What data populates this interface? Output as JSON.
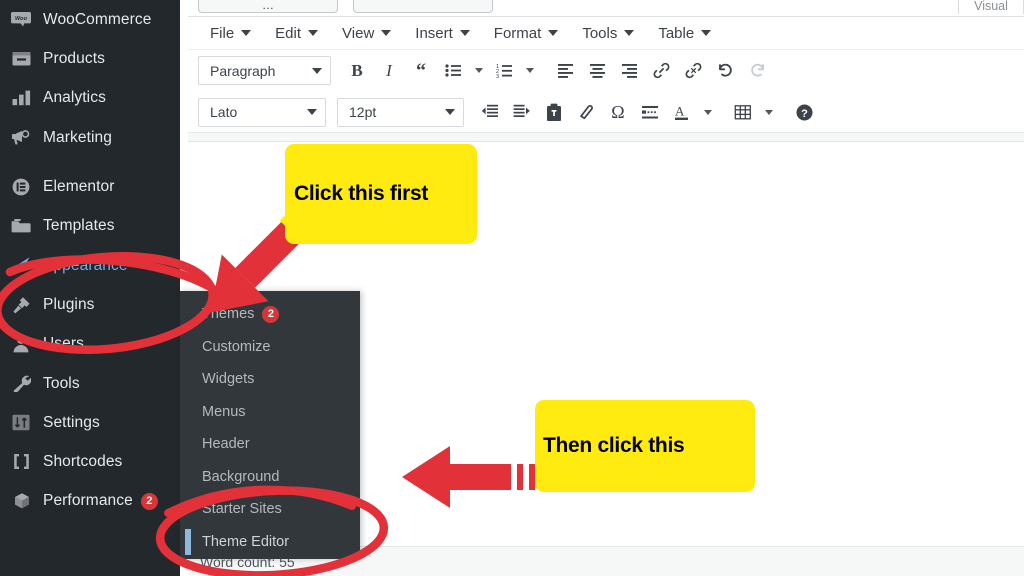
{
  "sidebar": {
    "items": [
      {
        "label": "WooCommerce",
        "icon": "woocommerce-icon",
        "badge": null,
        "active": false
      },
      {
        "label": "Products",
        "icon": "products-icon",
        "badge": null,
        "active": false
      },
      {
        "label": "Analytics",
        "icon": "analytics-icon",
        "badge": null,
        "active": false
      },
      {
        "label": "Marketing",
        "icon": "marketing-icon",
        "badge": null,
        "active": false
      },
      {
        "label": "Elementor",
        "icon": "elementor-icon",
        "badge": null,
        "active": false
      },
      {
        "label": "Templates",
        "icon": "templates-icon",
        "badge": null,
        "active": false
      },
      {
        "label": "Appearance",
        "icon": "appearance-icon",
        "badge": null,
        "active": true
      },
      {
        "label": "Plugins",
        "icon": "plugins-icon",
        "badge": null,
        "active": false
      },
      {
        "label": "Users",
        "icon": "users-icon",
        "badge": null,
        "active": false
      },
      {
        "label": "Tools",
        "icon": "tools-icon",
        "badge": null,
        "active": false
      },
      {
        "label": "Settings",
        "icon": "settings-icon",
        "badge": null,
        "active": false
      },
      {
        "label": "Shortcodes",
        "icon": "shortcodes-icon",
        "badge": null,
        "active": false
      },
      {
        "label": "Performance",
        "icon": "performance-icon",
        "badge": "2",
        "active": false
      }
    ]
  },
  "submenu": {
    "items": [
      {
        "label": "Themes",
        "badge": "2",
        "current": false
      },
      {
        "label": "Customize",
        "badge": null,
        "current": false
      },
      {
        "label": "Widgets",
        "badge": null,
        "current": false
      },
      {
        "label": "Menus",
        "badge": null,
        "current": false
      },
      {
        "label": "Header",
        "badge": null,
        "current": false
      },
      {
        "label": "Background",
        "badge": null,
        "current": false
      },
      {
        "label": "Starter Sites",
        "badge": null,
        "current": false
      },
      {
        "label": "Theme Editor",
        "badge": null,
        "current": true
      }
    ]
  },
  "editor": {
    "visual_tab_label": "Visual",
    "menubar": [
      "File",
      "Edit",
      "View",
      "Insert",
      "Format",
      "Tools",
      "Table"
    ],
    "format_select": "Paragraph",
    "font_select": "Lato",
    "size_select": "12pt",
    "row1_buttons": [
      "bold-icon",
      "italic-icon",
      "blockquote-icon",
      "bulleted-list-icon",
      "bulleted-list-caret-icon",
      "numbered-list-icon",
      "numbered-list-caret-icon",
      "align-left-icon",
      "align-center-icon",
      "align-right-icon",
      "insert-link-icon",
      "remove-link-icon",
      "undo-icon",
      "redo-icon"
    ],
    "row2_buttons": [
      "decrease-indent-icon",
      "increase-indent-icon",
      "paste-as-text-icon",
      "clear-formatting-icon",
      "special-character-icon",
      "insert-read-more-icon",
      "text-color-icon",
      "text-color-caret-icon",
      "table-icon",
      "table-caret-icon",
      "keyboard-shortcuts-icon"
    ],
    "word_count": "Word count: 55"
  },
  "annotations": {
    "callout_1": "Click this first",
    "callout_2": "Then click this",
    "highlight_color": "#ffeb10",
    "marker_color": "#e23138"
  }
}
